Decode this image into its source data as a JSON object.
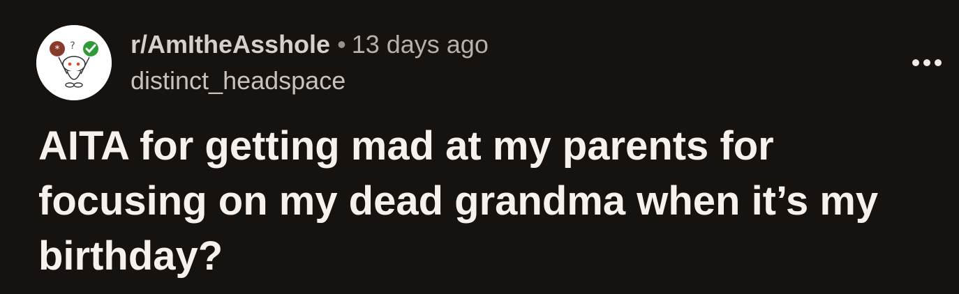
{
  "post": {
    "subreddit": "r/AmItheAsshole",
    "separator": "•",
    "time_ago": "13 days ago",
    "author": "distinct_headspace",
    "title": "AITA for getting mad at my parents for focusing on my dead grandma when it’s my birthday?"
  },
  "icons": {
    "avatar": "snoo-avatar-icon",
    "menu": "more-horizontal-icon"
  },
  "colors": {
    "background": "#161210",
    "title": "#f6f1ec",
    "meta": "#c9c1bb"
  }
}
